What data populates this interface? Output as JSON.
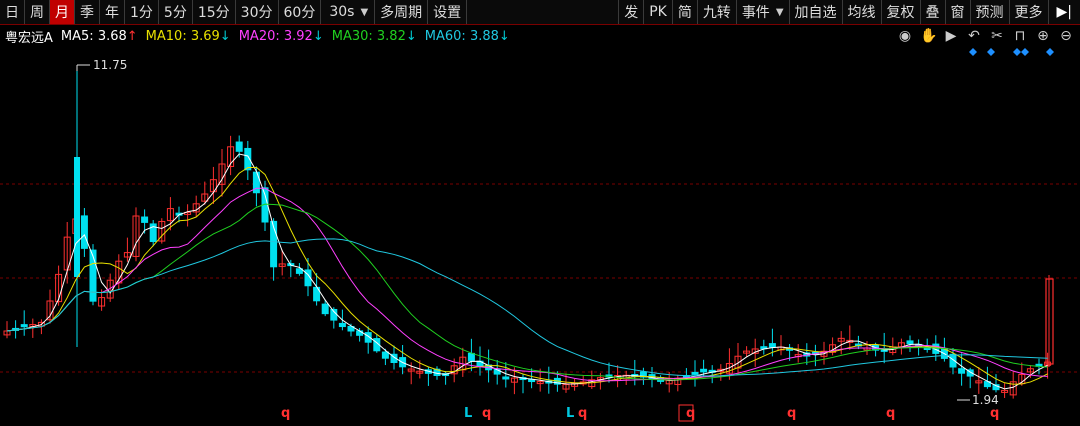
{
  "toolbar": {
    "left": [
      {
        "label": "日",
        "active": false
      },
      {
        "label": "周",
        "active": false
      },
      {
        "label": "月",
        "active": true
      },
      {
        "label": "季",
        "active": false
      },
      {
        "label": "年",
        "active": false
      },
      {
        "label": "1分",
        "active": false
      },
      {
        "label": "5分",
        "active": false
      },
      {
        "label": "15分",
        "active": false
      },
      {
        "label": "30分",
        "active": false
      },
      {
        "label": "60分",
        "active": false
      },
      {
        "label": "30s",
        "active": false,
        "dropdown": true
      },
      {
        "label": "多周期",
        "active": false
      },
      {
        "label": "设置",
        "active": false
      }
    ],
    "right": [
      {
        "label": "发"
      },
      {
        "label": "PK"
      },
      {
        "label": "简"
      },
      {
        "label": "九转"
      },
      {
        "label": "事件",
        "dropdown": true
      },
      {
        "label": "加自选"
      },
      {
        "label": "均线"
      },
      {
        "label": "复权"
      },
      {
        "label": "叠"
      },
      {
        "label": "窗"
      },
      {
        "label": "预测"
      },
      {
        "label": "更多"
      }
    ],
    "end_icon": "collapse-right-icon"
  },
  "info": {
    "stock_name": "粤宏远A",
    "ma": [
      {
        "label": "MA5:",
        "value": "3.68",
        "arrow": "↑",
        "color": "#ffffff"
      },
      {
        "label": "MA10:",
        "value": "3.69",
        "arrow": "↓",
        "color": "#e8e000"
      },
      {
        "label": "MA20:",
        "value": "3.92",
        "arrow": "↓",
        "color": "#ff40ff"
      },
      {
        "label": "MA30:",
        "value": "3.82",
        "arrow": "↓",
        "color": "#20d020"
      },
      {
        "label": "MA60:",
        "value": "3.88",
        "arrow": "↓",
        "color": "#20c8e0"
      }
    ]
  },
  "tools": [
    "eye-icon",
    "hand-icon",
    "play-icon",
    "undo-icon",
    "scissors-icon",
    "lock-icon",
    "zoom-in-icon",
    "zoom-out-icon"
  ],
  "annotations": {
    "high": "11.75",
    "low": "1.94"
  },
  "markers": [
    "q",
    "L",
    "q",
    "L",
    "q",
    "q",
    "q",
    "q",
    "q"
  ],
  "colors": {
    "up": "#ff3030",
    "down": "#00e0f0",
    "ma5": "#ffffff",
    "ma10": "#e8e000",
    "ma20": "#ff40ff",
    "ma30": "#20d020",
    "ma60": "#20c8e0",
    "grid": "#7a0000"
  }
}
